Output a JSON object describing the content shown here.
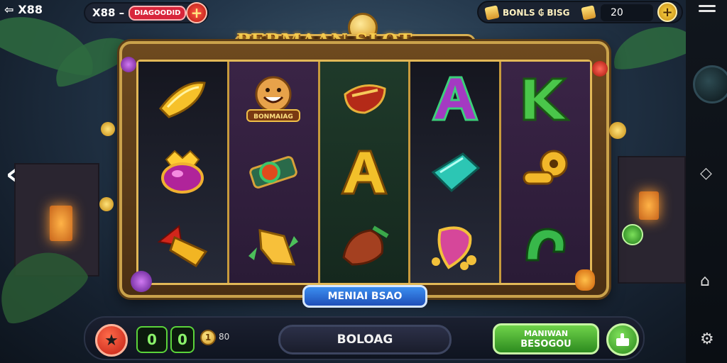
{
  "top_bar": {
    "back_label": "X88",
    "balance_prefix": "X88 –",
    "balance_pill": "DIAGOODID",
    "add_icon": "plus-icon",
    "bonus_label": "BONLS ₲ BISG",
    "coin_value": "20"
  },
  "game": {
    "title": "PERMAAN SLOT SERU",
    "menu_label": "MENIAI BSAO",
    "bonus_symbol_text": "BONMAIAG"
  },
  "bottom_bar": {
    "counter_one": "0",
    "counter_two": "0",
    "coin_glyph": "1",
    "bet_value": "80",
    "balance_text": "BOLOAG",
    "spin_line1": "MANIWAN",
    "spin_line2": "BESOGOU"
  },
  "colors": {
    "accent_gold": "#e2b857",
    "spin_green": "#2d8b1f",
    "menu_blue": "#1f4fb8",
    "alert_red": "#d8263b"
  },
  "reels": [
    [
      "banana-icon",
      "gem-purple-icon",
      "red-gold-arrow-icon"
    ],
    [
      "bonus-face-icon",
      "emerald-pipe-icon",
      "gold-leaf-icon"
    ],
    [
      "red-scroll-icon",
      "gold-letter-a-icon",
      "red-bell-icon"
    ],
    [
      "letter-a-purple-icon",
      "teal-crystal-icon",
      "pink-pendant-icon"
    ],
    [
      "letter-k-green-icon",
      "gold-key-icon",
      "green-horseshoe-icon"
    ]
  ]
}
